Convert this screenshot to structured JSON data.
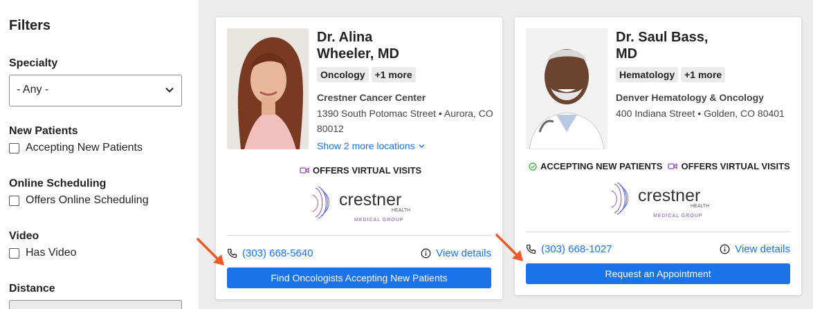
{
  "sidebar": {
    "title": "Filters",
    "specialty": {
      "label": "Specialty",
      "value": "- Any -"
    },
    "new_patients": {
      "label": "New Patients",
      "option": "Accepting New Patients"
    },
    "online_scheduling": {
      "label": "Online Scheduling",
      "option": "Offers Online Scheduling"
    },
    "video": {
      "label": "Video",
      "option": "Has Video"
    },
    "distance": {
      "label": "Distance"
    }
  },
  "cards": [
    {
      "name_line1": "Dr. Alina",
      "name_line2": "Wheeler, MD",
      "tags": [
        "Oncology",
        "+1 more"
      ],
      "practice": "Crestner Cancer Center",
      "address": "1390 South Potomac Street • Aurora, CO 80012",
      "more_locations": "Show 2 more locations",
      "badges": [
        "OFFERS VIRTUAL VISITS"
      ],
      "logo": {
        "word": "crestner",
        "sub": "HEALTH",
        "group": "MEDICAL GROUP"
      },
      "phone": "(303) 668-5640",
      "details": "View details",
      "cta": "Find Oncologists Accepting New Patients"
    },
    {
      "name_line1": "Dr. Saul Bass,",
      "name_line2": "MD",
      "tags": [
        "Hematology",
        "+1 more"
      ],
      "practice": "Denver Hematology & Oncology",
      "address": "400 Indiana Street • Golden, CO 80401",
      "badges": [
        "ACCEPTING NEW PATIENTS",
        "OFFERS VIRTUAL VISITS"
      ],
      "logo": {
        "word": "crestner",
        "sub": "HEALTH",
        "group": "MEDICAL GROUP"
      },
      "phone": "(303) 668-1027",
      "details": "View details",
      "cta": "Request an Appointment"
    }
  ],
  "colors": {
    "accent": "#1a73e8",
    "annotation_arrow": "#f05a28",
    "brand_purple": "#7a4fb3",
    "accept_green": "#3aa745"
  }
}
